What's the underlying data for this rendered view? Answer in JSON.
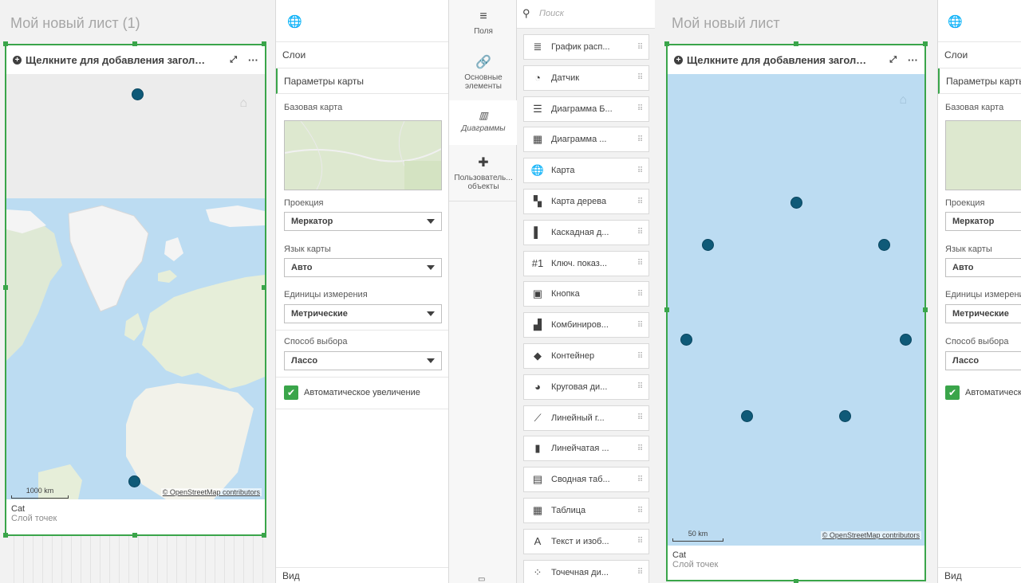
{
  "left_sheet": {
    "title": "Мой новый лист (1)",
    "map": {
      "header": "Щелкните для добавления заголовка",
      "footer_title": "Cat",
      "footer_sub": "Слой точек",
      "scale": "1000 km",
      "attribution": "© OpenStreetMap contributors"
    }
  },
  "left_props": {
    "globe": "🌐",
    "layers": "Слои",
    "map_settings": "Параметры карты",
    "base_map": "Базовая карта",
    "projection_label": "Проекция",
    "projection_value": "Меркатор",
    "language_label": "Язык карты",
    "language_value": "Авто",
    "units_label": "Единицы измерения",
    "units_value": "Метрические",
    "selection_label": "Способ выбора",
    "selection_value": "Лассо",
    "auto_zoom": "Автоматическое увеличение",
    "view": "Вид"
  },
  "assets": {
    "tabs": [
      {
        "icon": "≡",
        "label": "Поля"
      },
      {
        "icon": "🔗",
        "label": "Основные элементы"
      },
      {
        "icon": "▥",
        "label": "Диаграммы"
      },
      {
        "icon": "✚",
        "label": "Пользователь... объекты"
      }
    ]
  },
  "search": {
    "placeholder": "Поиск"
  },
  "charts": [
    {
      "icon": "≣",
      "label": "График расп..."
    },
    {
      "icon": "◔",
      "label": "Датчик"
    },
    {
      "icon": "☰",
      "label": "Диаграмма Б..."
    },
    {
      "icon": "▦",
      "label": "Диаграмма ..."
    },
    {
      "icon": "🌐",
      "label": "Карта"
    },
    {
      "icon": "▚",
      "label": "Карта дерева"
    },
    {
      "icon": "▌",
      "label": "Каскадная д..."
    },
    {
      "icon": "#1",
      "label": "Ключ. показ..."
    },
    {
      "icon": "▣",
      "label": "Кнопка"
    },
    {
      "icon": "▟",
      "label": "Комбиниров..."
    },
    {
      "icon": "◆",
      "label": "Контейнер"
    },
    {
      "icon": "◕",
      "label": "Круговая ди..."
    },
    {
      "icon": "⟋",
      "label": "Линейный г..."
    },
    {
      "icon": "▮",
      "label": "Линейчатая ..."
    },
    {
      "icon": "▤",
      "label": "Сводная таб..."
    },
    {
      "icon": "▦",
      "label": "Таблица"
    },
    {
      "icon": "A",
      "label": "Текст и изоб..."
    },
    {
      "icon": "⁘",
      "label": "Точечная ди..."
    }
  ],
  "right_sheet": {
    "title": "Мой новый лист",
    "map": {
      "header": "Щелкните для добавления заголовка",
      "footer_title": "Cat",
      "footer_sub": "Слой точек",
      "scale": "50 km",
      "attribution": "© OpenStreetMap contributors"
    }
  },
  "right_props": {
    "layers": "Слои",
    "map_settings": "Параметры карты",
    "base_map": "Базовая карта",
    "projection_label": "Проекция",
    "projection_value": "Меркатор",
    "language_label": "Язык карты",
    "language_value": "Авто",
    "units_label": "Единицы измерения",
    "units_value": "Метрические",
    "selection_label": "Способ выбора",
    "selection_value": "Лассо",
    "auto_zoom": "Автоматическое увеличение",
    "view": "Вид"
  },
  "colors": {
    "accent": "#3aa54a",
    "point": "#0f5a78",
    "water": "#bcdcf2"
  }
}
